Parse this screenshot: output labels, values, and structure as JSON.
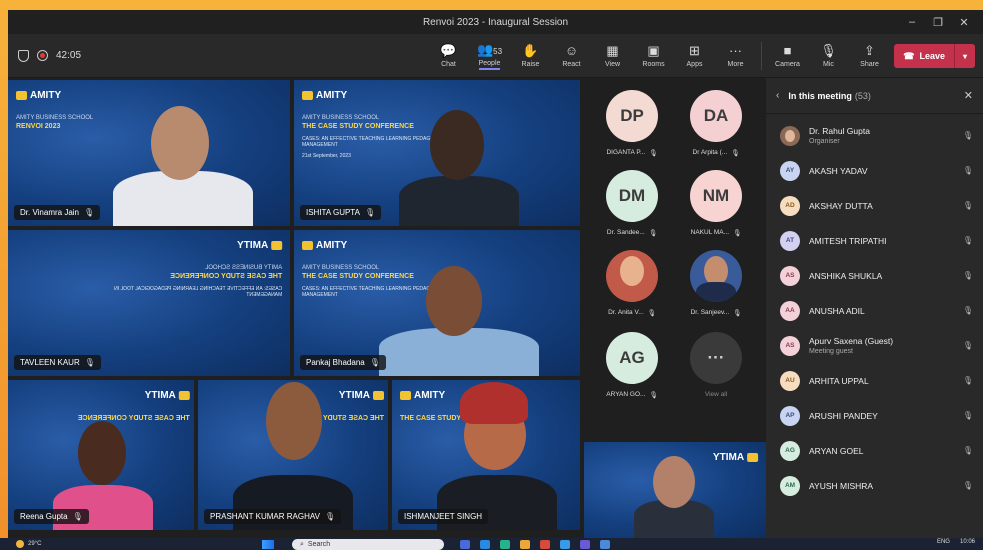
{
  "window": {
    "title": "Renvoi 2023 - Inaugural Session"
  },
  "toolbar": {
    "timer": "42:05",
    "people_count": "53",
    "tools": [
      "Chat",
      "People",
      "Raise",
      "React",
      "View",
      "Rooms",
      "Apps",
      "More"
    ],
    "devices": [
      "Camera",
      "Mic",
      "Share"
    ],
    "leave_label": "Leave"
  },
  "slide": {
    "logo": "AMITY",
    "logo_sub": "UNIVERSITY",
    "school": "AMITY BUSINESS SCHOOL",
    "event": "RENVOI 2023",
    "conference": "THE CASE STUDY CONFERENCE",
    "theme_label": "THEME:",
    "theme": "CASES: AN EFFECTIVE TEACHING LEARNING PEDAGOGICAL TOOL IN MANAGEMENT",
    "date": "21st September, 2023"
  },
  "tiles": [
    {
      "name": "Dr. Vinamra Jain"
    },
    {
      "name": "ISHITA GUPTA"
    },
    {
      "name": "TAVLEEN KAUR"
    },
    {
      "name": "Pankaj Bhadana"
    },
    {
      "name": "Reena Gupta"
    },
    {
      "name": "PRASHANT KUMAR RAGHAV"
    },
    {
      "name": "ISHMANJEET SINGH"
    }
  ],
  "avatars": [
    {
      "initials": "DP",
      "name": "DIGANTA P...",
      "color": "#f3dbd3"
    },
    {
      "initials": "DA",
      "name": "Dr Arpita (...",
      "color": "#f4d0d3"
    },
    {
      "initials": "DM",
      "name": "Dr. Sandee...",
      "color": "#d5ecdf"
    },
    {
      "initials": "NM",
      "name": "NAKUL MA...",
      "color": "#f7d3d2"
    },
    {
      "initials": "",
      "name": "Dr. Anita V...",
      "color": "#c25a4a"
    },
    {
      "initials": "",
      "name": "Dr. Sanjeev...",
      "color": "#3a5b9a"
    },
    {
      "initials": "AG",
      "name": "ARYAN GO...",
      "color": "#d6ecdf"
    },
    {
      "initials": "···",
      "name": "View all",
      "color": "#3a3a3a"
    }
  ],
  "panel": {
    "title": "In this meeting",
    "count": "(53)",
    "participants": [
      {
        "initials": "",
        "name": "Dr. Rahul Gupta",
        "sub": "Organiser",
        "color": "#8a6a56"
      },
      {
        "initials": "AY",
        "name": "AKASH YADAV",
        "sub": "",
        "color": "#c9d4f2"
      },
      {
        "initials": "AD",
        "name": "AKSHAY DUTTA",
        "sub": "",
        "color": "#f6ddc0"
      },
      {
        "initials": "AT",
        "name": "AMITESH TRIPATHI",
        "sub": "",
        "color": "#d3d0f0"
      },
      {
        "initials": "AS",
        "name": "ANSHIKA SHUKLA",
        "sub": "",
        "color": "#f3d1d8"
      },
      {
        "initials": "AA",
        "name": "ANUSHA ADIL",
        "sub": "",
        "color": "#f3d1d8"
      },
      {
        "initials": "AS",
        "name": "Apurv Saxena (Guest)",
        "sub": "Meeting guest",
        "color": "#f3d1d8"
      },
      {
        "initials": "AU",
        "name": "ARHITA UPPAL",
        "sub": "",
        "color": "#f6ddc0"
      },
      {
        "initials": "AP",
        "name": "ARUSHI PANDEY",
        "sub": "",
        "color": "#c9d4f2"
      },
      {
        "initials": "AG",
        "name": "ARYAN GOEL",
        "sub": "",
        "color": "#d6ecdf"
      },
      {
        "initials": "AM",
        "name": "AYUSH MISHRA",
        "sub": "",
        "color": "#d6ecdf"
      }
    ]
  },
  "taskbar": {
    "temperature": "29°C",
    "search_placeholder": "Search",
    "language": "ENG",
    "time": "10:06"
  }
}
